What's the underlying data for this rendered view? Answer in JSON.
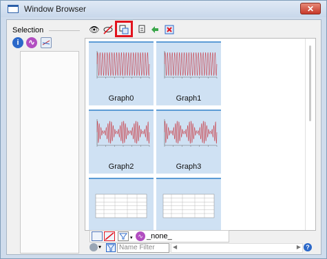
{
  "window": {
    "title": "Window Browser",
    "close_glyph": "✕"
  },
  "left_panel": {
    "section_label": "Selection",
    "icons": [
      "info-icon",
      "waveform-icon",
      "graph-icon"
    ]
  },
  "toolbar": {
    "icons": [
      "eye-icon",
      "hide-icon",
      "duplicate-window-icon",
      "copy-window-icon",
      "arrange-icon",
      "delete-window-icon"
    ]
  },
  "tiles": [
    {
      "label": "Graph0",
      "kind": "fast-sine"
    },
    {
      "label": "Graph1",
      "kind": "fast-sine"
    },
    {
      "label": "Graph2",
      "kind": "beat-signal"
    },
    {
      "label": "Graph3",
      "kind": "beat-signal"
    },
    {
      "label": "",
      "kind": "table"
    },
    {
      "label": "",
      "kind": "table"
    }
  ],
  "bottom_bar": {
    "selected_item": "_none_"
  },
  "filter": {
    "placeholder": "Name Filter"
  },
  "colors": {
    "accent": "#5b9bd5",
    "tile_bg": "#cfe1f3",
    "trace": "#c8414b",
    "highlight": "#e2131d"
  }
}
